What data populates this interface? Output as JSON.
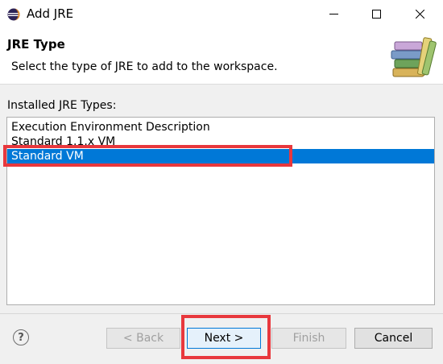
{
  "window": {
    "title": "Add JRE",
    "icon": "eclipse-icon"
  },
  "banner": {
    "title": "JRE Type",
    "description": "Select the type of JRE to add to the workspace.",
    "graphic": "books-icon"
  },
  "list": {
    "label": "Installed JRE Types:",
    "items": [
      {
        "label": "Execution Environment Description",
        "selected": false
      },
      {
        "label": "Standard 1.1.x VM",
        "selected": false
      },
      {
        "label": "Standard VM",
        "selected": true
      }
    ]
  },
  "buttons": {
    "help_icon": "?",
    "back": "< Back",
    "next": "Next >",
    "finish": "Finish",
    "cancel": "Cancel"
  },
  "colors": {
    "selection": "#0078d7",
    "annotation": "#e8383d"
  }
}
